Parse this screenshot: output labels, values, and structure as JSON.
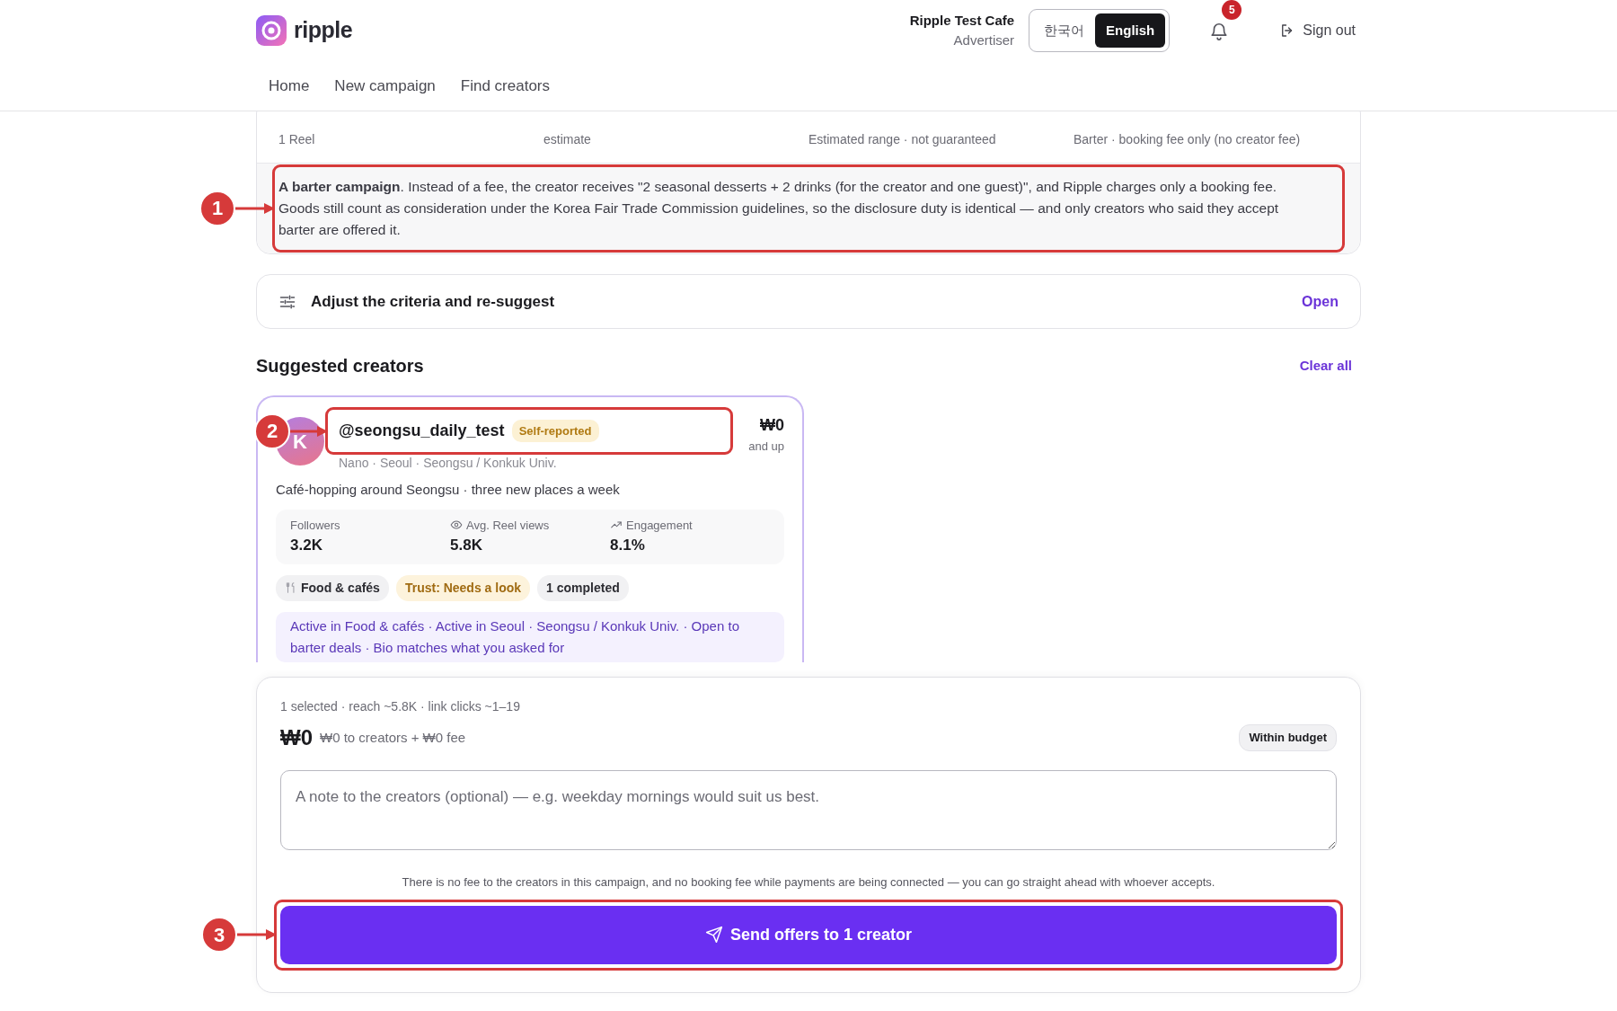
{
  "header": {
    "logo": "ripple",
    "account": {
      "name": "Ripple Test Cafe",
      "role": "Advertiser"
    },
    "languages": [
      {
        "label": "한국어",
        "selected": false
      },
      {
        "label": "English",
        "selected": true
      }
    ],
    "notifications": "5",
    "sign_out": "Sign out"
  },
  "nav": [
    {
      "label": "Home"
    },
    {
      "label": "New campaign"
    },
    {
      "label": "Find creators"
    }
  ],
  "summary": {
    "stats": [
      {
        "note": "1 Reel"
      },
      {
        "note": "estimate"
      },
      {
        "note": "Estimated range · not guaranteed"
      },
      {
        "note": "Barter · booking fee only (no creator fee)"
      }
    ],
    "barter_note": "**A barter campaign**. Instead of a fee, the creator receives \"2 seasonal desserts + 2 drinks (for the creator and one guest)\", and Ripple charges only a booking fee. Goods still count as consideration under the Korea Fair Trade Commission guidelines, so the disclosure duty is identical — and only creators who said they accept barter are offered it.",
    "annotation": "1"
  },
  "adjust": {
    "title": "Adjust the criteria and re-suggest",
    "action": "Open"
  },
  "suggested": {
    "title": "Suggested creators",
    "clear": "Clear all",
    "creators": [
      {
        "avatar": "K",
        "handle": "@seongsu_daily_test",
        "badge": "Self-reported",
        "annotation": "2",
        "meta": "Nano · Seoul · Seongsu / Konkuk Univ.",
        "price": "₩0",
        "price_note": "and up",
        "bio": "Café-hopping around Seongsu · three new places a week",
        "metrics": [
          {
            "kind": "count",
            "label": "Followers",
            "value": "3.2K"
          },
          {
            "kind": "views",
            "label": "Avg. Reel views",
            "value": "5.8K"
          },
          {
            "kind": "rate",
            "label": "Engagement",
            "value": "8.1%"
          }
        ],
        "tags": [
          {
            "kind": "category",
            "label": "Food & cafés"
          },
          {
            "kind": "warning",
            "label": "Trust: Needs a look"
          },
          {
            "kind": "neutral",
            "label": "1 completed"
          }
        ],
        "match": "Active in Food & cafés · Active in Seoul · Seongsu / Konkuk Univ. · Open to barter deals · Bio matches what you asked for"
      }
    ]
  },
  "checkout": {
    "summary": "1 selected · reach ~5.8K · link clicks ~1–19",
    "total": "₩0",
    "breakdown": "₩0 to creators + ₩0 fee",
    "budget": "Within budget",
    "note_placeholder": "A note to the creators (optional) — e.g. weekday mornings would suit us best.",
    "info": "There is no fee to the creators in this campaign, and no booking fee while payments are being connected — you can go straight ahead with whoever accepts.",
    "send": "Send offers to 1 creator",
    "annotation": "3"
  }
}
